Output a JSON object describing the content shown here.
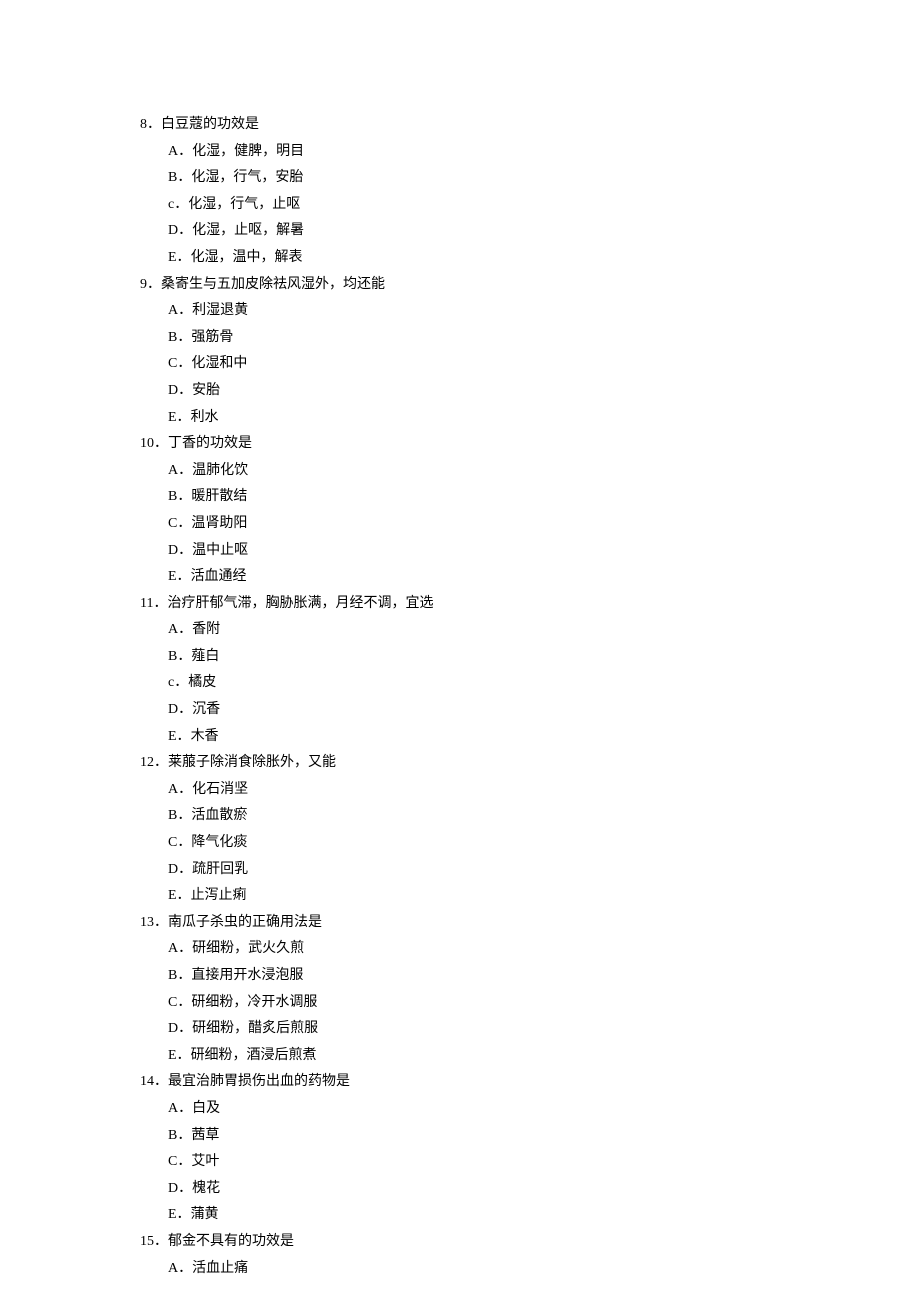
{
  "questions": [
    {
      "number": "8．",
      "text": "白豆蔻的功效是",
      "options": [
        {
          "label": "A．",
          "text": "化湿，健脾，明目"
        },
        {
          "label": "B．",
          "text": "化湿，行气，安胎"
        },
        {
          "label": "c．",
          "text": "化湿，行气，止呕"
        },
        {
          "label": "D．",
          "text": "化湿，止呕，解暑"
        },
        {
          "label": "E．",
          "text": "化湿，温中，解表"
        }
      ]
    },
    {
      "number": "9．",
      "text": "桑寄生与五加皮除祛风湿外，均还能",
      "options": [
        {
          "label": "A．",
          "text": "利湿退黄"
        },
        {
          "label": "B．",
          "text": "强筋骨"
        },
        {
          "label": "C．",
          "text": "化湿和中"
        },
        {
          "label": "D．",
          "text": "安胎"
        },
        {
          "label": "E．",
          "text": "利水"
        }
      ]
    },
    {
      "number": "10．",
      "text": "丁香的功效是",
      "options": [
        {
          "label": "A．",
          "text": "温肺化饮"
        },
        {
          "label": "B．",
          "text": "暖肝散结"
        },
        {
          "label": "C．",
          "text": "温肾助阳"
        },
        {
          "label": "D．",
          "text": "温中止呕"
        },
        {
          "label": "E．",
          "text": "活血通经"
        }
      ]
    },
    {
      "number": "11．",
      "text": "治疗肝郁气滞，胸胁胀满，月经不调，宜选",
      "options": [
        {
          "label": "A．",
          "text": "香附"
        },
        {
          "label": "B．",
          "text": "薤白"
        },
        {
          "label": "c．",
          "text": "橘皮"
        },
        {
          "label": "D．",
          "text": "沉香"
        },
        {
          "label": "E．",
          "text": "木香"
        }
      ]
    },
    {
      "number": "12．",
      "text": "莱菔子除消食除胀外，又能",
      "options": [
        {
          "label": "A．",
          "text": "化石消坚"
        },
        {
          "label": "B．",
          "text": "活血散瘀"
        },
        {
          "label": "C．",
          "text": "降气化痰"
        },
        {
          "label": "D．",
          "text": "疏肝回乳"
        },
        {
          "label": "E．",
          "text": "止泻止痢"
        }
      ]
    },
    {
      "number": "13．",
      "text": "南瓜子杀虫的正确用法是",
      "options": [
        {
          "label": "A．",
          "text": "研细粉，武火久煎"
        },
        {
          "label": "B．",
          "text": "直接用开水浸泡服"
        },
        {
          "label": "C．",
          "text": "研细粉，冷开水调服"
        },
        {
          "label": "D．",
          "text": "研细粉，醋炙后煎服"
        },
        {
          "label": "E．",
          "text": "研细粉，酒浸后煎煮"
        }
      ]
    },
    {
      "number": "14．",
      "text": "最宜治肺胃损伤出血的药物是",
      "options": [
        {
          "label": "A．",
          "text": "白及"
        },
        {
          "label": "B．",
          "text": "茜草"
        },
        {
          "label": "C．",
          "text": "艾叶"
        },
        {
          "label": "D．",
          "text": "槐花"
        },
        {
          "label": "E．",
          "text": "蒲黄"
        }
      ]
    },
    {
      "number": "15．",
      "text": "郁金不具有的功效是",
      "options": [
        {
          "label": "A．",
          "text": "活血止痛"
        }
      ]
    }
  ]
}
